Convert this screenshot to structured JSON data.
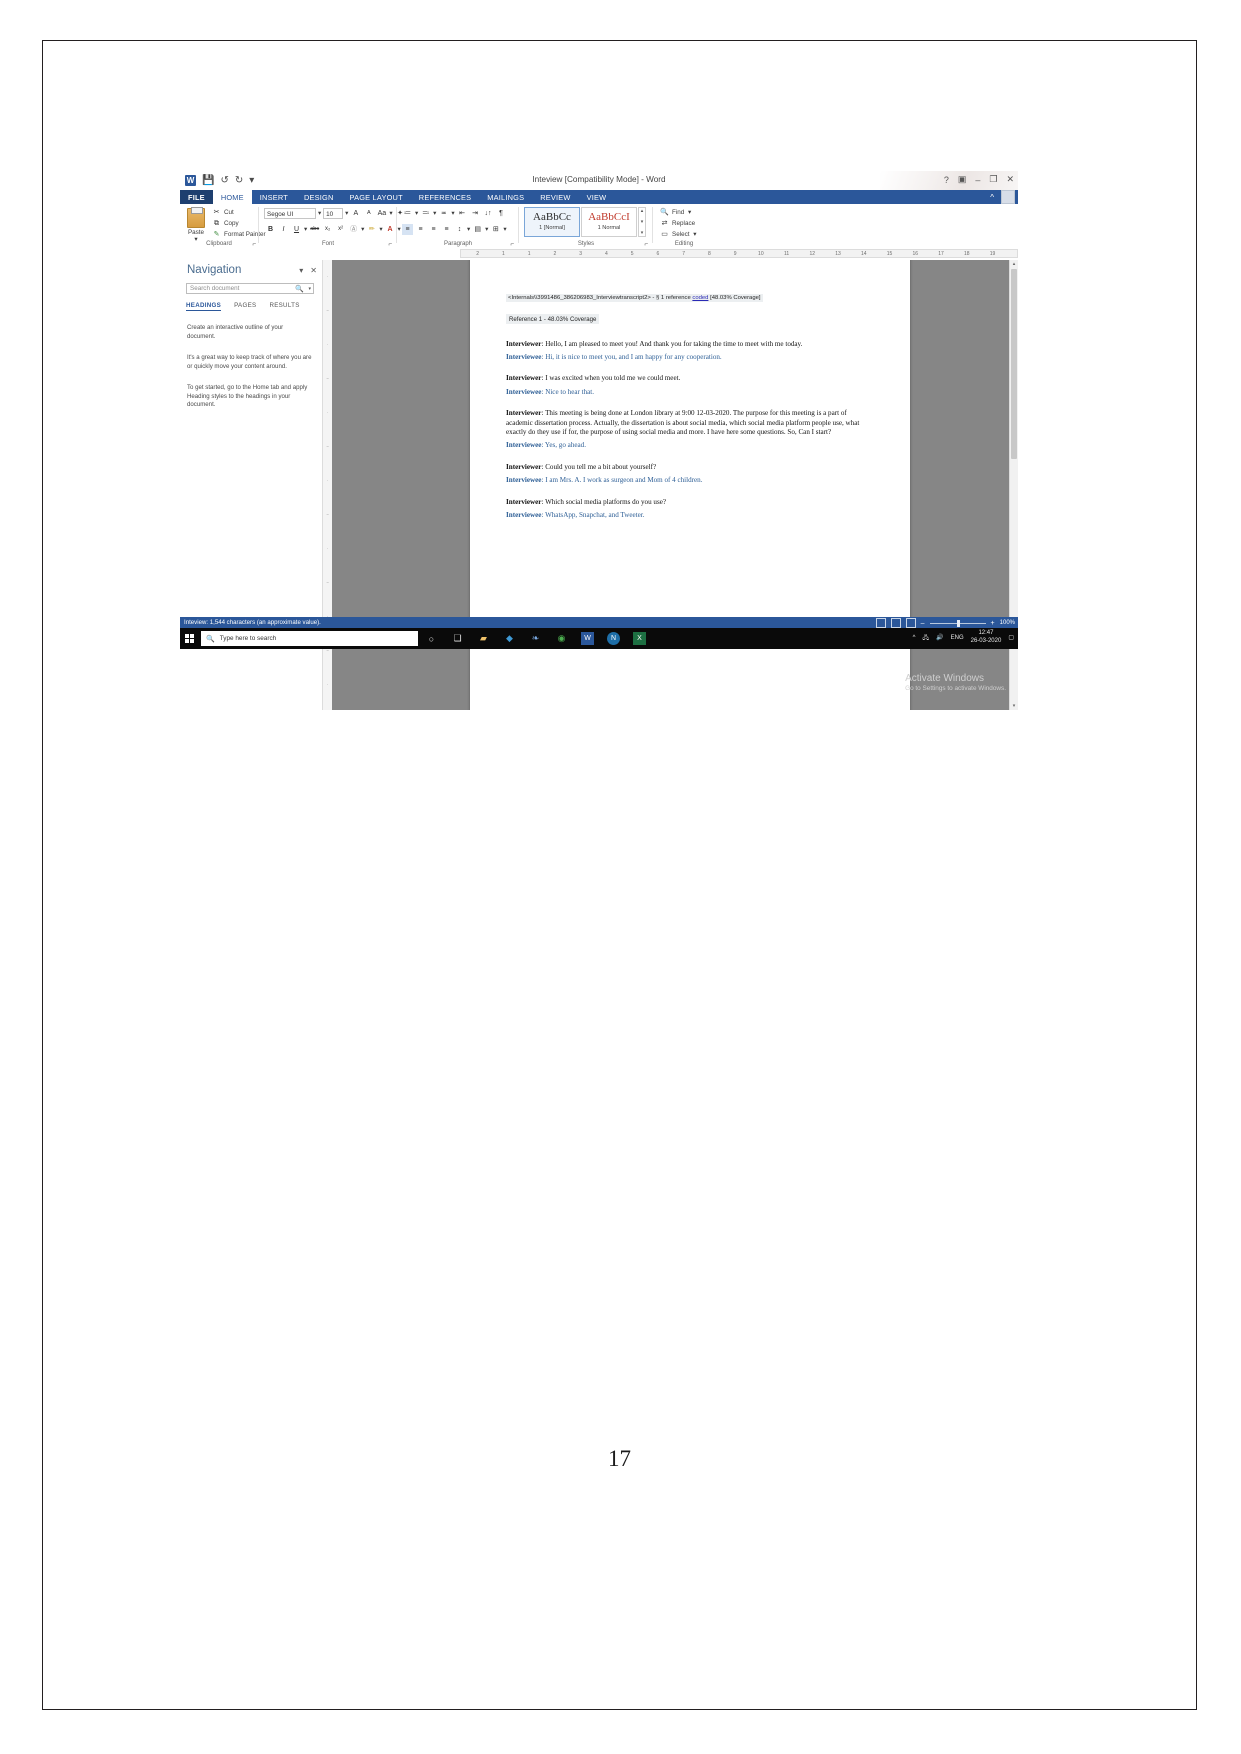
{
  "printed_page": {
    "page_number": "17"
  },
  "titlebar": {
    "document_title": "Inteview [Compatibility Mode] - Word",
    "word_icon": "W",
    "save_icon": "save-icon",
    "undo_icon": "↺",
    "redo_icon": "↻",
    "customize_icon": "▾",
    "help_icon": "?",
    "ribbon_display_icon": "▣",
    "minimize_icon": "–",
    "restore_icon": "❐",
    "close_icon": "✕"
  },
  "ribbon": {
    "tabs": [
      {
        "label": "FILE"
      },
      {
        "label": "HOME"
      },
      {
        "label": "INSERT"
      },
      {
        "label": "DESIGN"
      },
      {
        "label": "PAGE LAYOUT"
      },
      {
        "label": "REFERENCES"
      },
      {
        "label": "MAILINGS"
      },
      {
        "label": "REVIEW"
      },
      {
        "label": "VIEW"
      }
    ],
    "active_tab": "HOME",
    "collapse_ribbon_icon": "^",
    "groups": {
      "clipboard": {
        "label": "Clipboard",
        "paste": "Paste",
        "cut": "Cut",
        "copy": "Copy",
        "format_painter": "Format Painter",
        "launcher_icon": "⌐"
      },
      "font": {
        "label": "Font",
        "font_name": "Segoe UI",
        "font_size": "10",
        "grow_font": "A",
        "shrink_font": "A",
        "change_case": "Aa",
        "clear_formatting": "✦",
        "bold": "B",
        "italic": "I",
        "underline": "U",
        "strikethrough": "abc",
        "subscript": "x₂",
        "superscript": "x²",
        "text_effects": "A",
        "highlight": "ab",
        "font_color": "A",
        "launcher_icon": "⌐"
      },
      "paragraph": {
        "label": "Paragraph",
        "bullets": "≔",
        "numbering": "≕",
        "multilevel": "≖",
        "decrease_indent": "⇤",
        "increase_indent": "⇥",
        "sort": "↓↑",
        "show_marks": "¶",
        "align_left": "≡",
        "align_center": "≡",
        "align_right": "≡",
        "justify": "≡",
        "line_spacing": "↕",
        "shading": "▤",
        "borders": "⊞",
        "launcher_icon": "⌐"
      },
      "styles": {
        "label": "Styles",
        "items": [
          {
            "preview": "AaBbCc",
            "name": "1 [Normal]",
            "selected": true
          },
          {
            "preview": "AaBbCcI",
            "name": "1 Normal",
            "selected": false
          }
        ],
        "launcher_icon": "⌐"
      },
      "editing": {
        "label": "Editing",
        "find": "Find",
        "replace": "Replace",
        "select": "Select"
      }
    }
  },
  "ruler": {
    "ticks": [
      "2",
      "1",
      "1",
      "2",
      "3",
      "4",
      "5",
      "6",
      "7",
      "8",
      "9",
      "10",
      "11",
      "12",
      "13",
      "14",
      "15",
      "16",
      "17",
      "18",
      "19"
    ]
  },
  "navigation": {
    "title": "Navigation",
    "collapse_icon": "▾",
    "close_icon": "✕",
    "search_placeholder": "Search document",
    "search_value": "",
    "search_icon": "search-icon",
    "search_dropdown_icon": "▾",
    "tabs": [
      {
        "label": "HEADINGS",
        "active": true
      },
      {
        "label": "PAGES",
        "active": false
      },
      {
        "label": "RESULTS",
        "active": false
      }
    ],
    "hints": [
      "Create an interactive outline of your document.",
      "It's a great way to keep track of where you are or quickly move your content around.",
      "To get started, go to the Home tab and apply Heading styles to the headings in your document."
    ]
  },
  "document": {
    "source_header": {
      "prefix": "<Internals\\\\3991486_386206983_Interviewtranscript2> - § 1 reference ",
      "link": "coded",
      "suffix": "  [48.03% Coverage]"
    },
    "reference_line": "Reference 1 - 48.03% Coverage",
    "exchanges": [
      {
        "speaker": "Interviewer",
        "text": ": Hello, I am pleased to meet you! And thank you for taking the time to meet with me today.",
        "role": "q"
      },
      {
        "speaker": "Interviewee",
        "text": ": Hi, it is nice to meet you, and I am happy for any cooperation.",
        "role": "a"
      },
      {
        "speaker": "Interviewer",
        "text": ": I was excited when you told me we could meet.",
        "role": "q"
      },
      {
        "speaker": "Interviewee",
        "text": ": Nice to hear that.",
        "role": "a"
      },
      {
        "speaker": "Interviewer",
        "text": ": This meeting is being done at London library at 9:00 12-03-2020. The purpose for this meeting is a part of academic dissertation process. Actually, the dissertation is about social media, which social media platform people use, what exactly do they use if for, the purpose of using social media and more. I have here some questions. So, Can I start?",
        "role": "q"
      },
      {
        "speaker": "Interviewee",
        "text": ": Yes, go ahead.",
        "role": "a"
      },
      {
        "speaker": "Interviewer",
        "text": ": Could you tell me a bit about yourself?",
        "role": "q"
      },
      {
        "speaker": "Interviewee",
        "text": ": I am Mrs. A. I work as surgeon and Mom of 4 children.",
        "role": "a"
      },
      {
        "speaker": "Interviewer",
        "text": ": Which social media platforms do you use?",
        "role": "q"
      },
      {
        "speaker": "Interviewee",
        "text": ": WhatsApp, Snapchat, and Tweeter.",
        "role": "a"
      }
    ]
  },
  "watermark": {
    "line1": "Activate Windows",
    "line2": "Go to Settings to activate Windows."
  },
  "statusbar": {
    "text": "Inteview: 1,544 characters (an approximate value).",
    "read_mode_icon": "read-mode-icon",
    "print_layout_icon": "print-layout-icon",
    "web_layout_icon": "web-layout-icon",
    "zoom_out": "–",
    "zoom_in": "+",
    "zoom_level": "100%"
  },
  "taskbar": {
    "start_icon": "windows-start-icon",
    "search_placeholder": "Type here to search",
    "search_icon": "search-icon",
    "cortana_icon": "○",
    "task_view_icon": "task-view-icon",
    "apps": [
      {
        "name": "file-explorer-icon",
        "glyph": "▰"
      },
      {
        "name": "nvivo-icon",
        "glyph": "◆"
      },
      {
        "name": "photos-icon",
        "glyph": "❧"
      },
      {
        "name": "chrome-icon",
        "glyph": "◉"
      },
      {
        "name": "word-icon",
        "glyph": "W"
      },
      {
        "name": "nvivo-app-icon",
        "glyph": "N"
      },
      {
        "name": "excel-icon",
        "glyph": "X"
      }
    ],
    "tray": {
      "show_hidden_icon": "^",
      "network_icon": "network-icon",
      "volume_icon": "volume-icon",
      "language": "ENG",
      "time": "12:47",
      "date": "26-03-2020",
      "notifications_icon": "notification-icon"
    }
  }
}
